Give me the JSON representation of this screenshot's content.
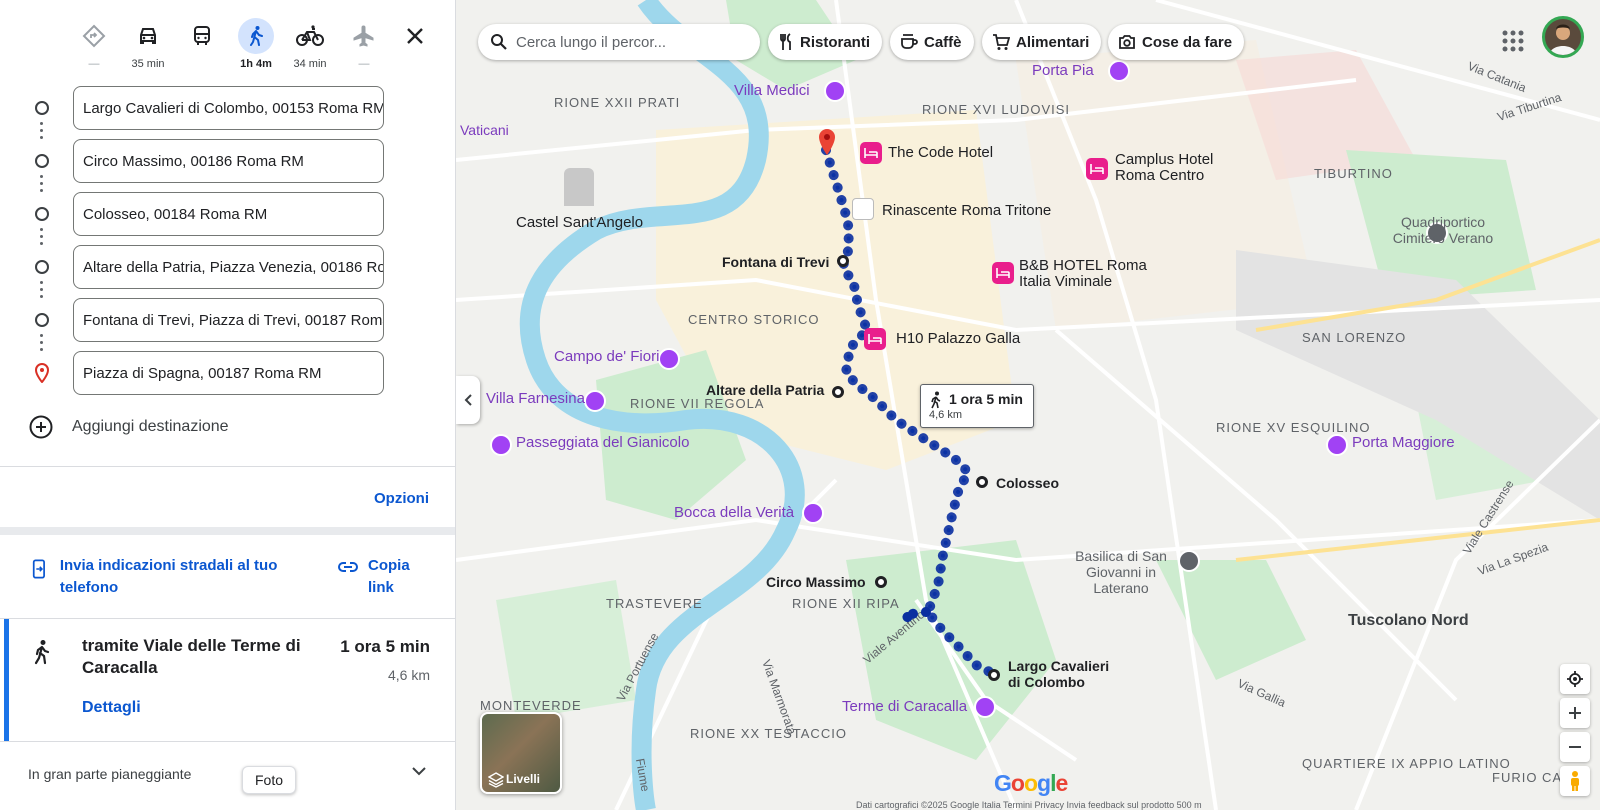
{
  "modes": [
    {
      "name": "best",
      "label": "—"
    },
    {
      "name": "car",
      "label": "35 min"
    },
    {
      "name": "transit",
      "label": ""
    },
    {
      "name": "walk",
      "label": "1h 4m"
    },
    {
      "name": "bike",
      "label": "34 min"
    },
    {
      "name": "flight",
      "label": "—"
    }
  ],
  "stops": [
    "Largo Cavalieri di Colombo, 00153 Roma RM",
    "Circo Massimo, 00186 Roma RM",
    "Colosseo, 00184 Roma RM",
    "Altare della Patria, Piazza Venezia, 00186 Roma RM",
    "Fontana di Trevi, Piazza di Trevi, 00187 Roma RM",
    "Piazza di Spagna, 00187 Roma RM"
  ],
  "add_destination": "Aggiungi destinazione",
  "options": "Opzioni",
  "send_to_phone": "Invia indicazioni stradali al tuo telefono",
  "copy_link": "Copia link",
  "route": {
    "via": "tramite Viale delle Terme di Caracalla",
    "duration": "1 ora 5 min",
    "distance": "4,6 km",
    "details": "Dettagli",
    "terrain": "In gran parte pianeggiante"
  },
  "photo_tooltip": "Foto",
  "map": {
    "search_placeholder": "Cerca lungo il percor...",
    "chips": [
      "Ristoranti",
      "Caffè",
      "Alimentari",
      "Cose da fare"
    ],
    "callout_duration": "1 ora 5 min",
    "callout_distance": "4,6 km",
    "layers": "Livelli",
    "logo": "Google",
    "stop_labels": [
      "Fontana di Trevi",
      "Altare della Patria",
      "Colosseo",
      "Circo Massimo",
      "Largo Cavalieri di Colombo"
    ],
    "hotels": [
      "The Code Hotel",
      "Camplus Hotel Roma Centro",
      "B&B HOTEL Roma Italia Viminale",
      "H10 Palazzo Galla"
    ],
    "pois": [
      "Villa Medici",
      "Porta Pia",
      "Castel Sant'Angelo",
      "Rinascente Roma Tritone",
      "Quadriportico Cimitero Verano",
      "Campo de' Fiori",
      "Villa Farnesina",
      "Passeggiata del Gianicolo",
      "Porta Maggiore",
      "Bocca della Verità",
      "Basilica di San Giovanni in Laterano",
      "Terme di Caracalla"
    ],
    "districts": [
      "RIONE XXII PRATI",
      "RIONE XVI LUDOVISI",
      "TIBURTINO",
      "CENTRO STORICO",
      "SAN LORENZO",
      "RIONE VII REGOLA",
      "RIONE XV ESQUILINO",
      "TRASTEVERE",
      "RIONE XII RIPA",
      "Tuscolano Nord",
      "MONTEVERDE",
      "RIONE XX TESTACCIO",
      "QUARTIERE IX APPIO LATINO",
      "FURIO CA"
    ],
    "streets": [
      "Via Catania",
      "Via Tiburtina",
      "Viale Castrense",
      "Via La Spezia",
      "Viale Aventino",
      "Via Gallia",
      "Via Portuense",
      "Via Marmorata",
      "Vaticani",
      "Fiume"
    ],
    "footer": "Dati cartografici ©2025 Google  Italia   Termini   Privacy   Invia feedback sul prodotto   500 m"
  }
}
